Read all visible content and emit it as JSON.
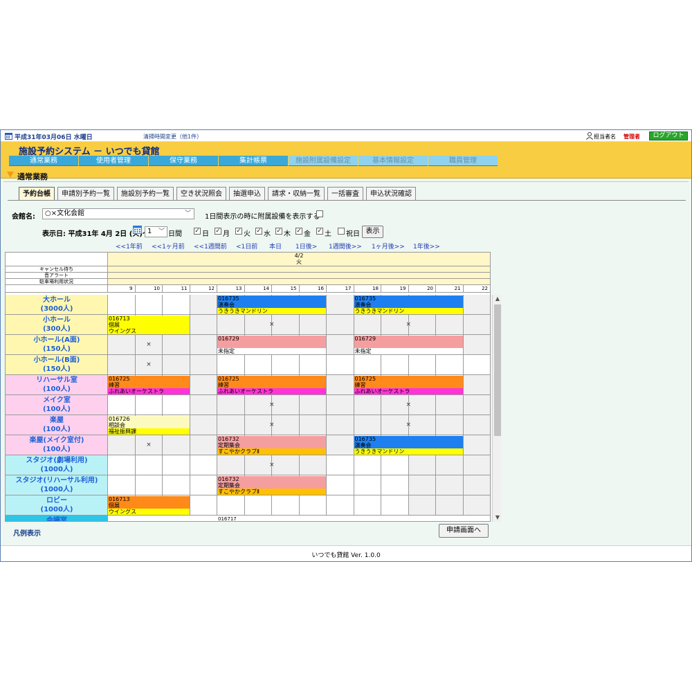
{
  "topbar": {
    "date": "平成31年03月06日 水曜日",
    "notice": "清掃時間変更（他1件）",
    "user_label": "担当者名",
    "user_role": "管理者",
    "logout": "ログアウト"
  },
  "header": {
    "title": "施設予約システム － いつでも貸館",
    "nav": [
      {
        "label": "通常業務",
        "light": false
      },
      {
        "label": "使用者管理",
        "light": false
      },
      {
        "label": "保守業務",
        "light": false
      },
      {
        "label": "集計帳票",
        "light": false
      },
      {
        "label": "施設附属設備設定",
        "light": true
      },
      {
        "label": "基本情報設定",
        "light": true
      },
      {
        "label": "職員管理",
        "light": true
      }
    ]
  },
  "section": {
    "label": "通常業務"
  },
  "tabs": [
    "予約台帳",
    "申請別予約一覧",
    "施設別予約一覧",
    "空き状況照会",
    "抽選申込",
    "請求・収納一覧",
    "一括審査",
    "申込状況確認"
  ],
  "form": {
    "hall_label": "会館名:",
    "hall_value": "○×文化会館",
    "equip_label": "1日間表示の時に附属設備を表示する",
    "date_label": "表示日: 平成31年 4月 2日 (火)～",
    "days_value": "1",
    "days_suffix": "日間",
    "weekdays": [
      {
        "label": "日",
        "checked": true
      },
      {
        "label": "月",
        "checked": true
      },
      {
        "label": "火",
        "checked": true
      },
      {
        "label": "水",
        "checked": true
      },
      {
        "label": "木",
        "checked": true
      },
      {
        "label": "金",
        "checked": true
      },
      {
        "label": "土",
        "checked": true
      },
      {
        "label": "祝日",
        "checked": false
      }
    ],
    "show_button": "表示"
  },
  "nav_links": [
    "<<1年前",
    "<<1ヶ月前",
    "<<1週間前",
    "<1日前",
    "本日",
    "1日後>",
    "1週間後>>",
    "1ヶ月後>>",
    "1年後>>"
  ],
  "grid": {
    "date": "4/2",
    "weekday": "火",
    "info_rows": [
      "キャンセル待ち",
      "音アラート",
      "駐車場利用状況"
    ],
    "hours": [
      "9",
      "10",
      "11",
      "12",
      "13",
      "14",
      "15",
      "16",
      "17",
      "18",
      "19",
      "20",
      "21",
      "22"
    ],
    "rows": [
      {
        "name": "大ホール",
        "cap": "(3000人)",
        "bg": "#fff7b0",
        "slots": [
          "w",
          "w",
          "w",
          "g",
          "b",
          "b",
          "b",
          "b",
          "g",
          "b",
          "b",
          "b",
          "b",
          "g"
        ]
      },
      {
        "name": "小ホール",
        "cap": "(300人)",
        "bg": "#fff7b0",
        "slots": [
          "b",
          "b",
          "b",
          "g",
          "g",
          "g",
          "g",
          "g",
          "g",
          "g",
          "g",
          "g",
          "g",
          "g"
        ]
      },
      {
        "name": "小ホール(A面)",
        "cap": "(150人)",
        "bg": "#fff7b0",
        "slots": [
          "g",
          "g",
          "g",
          "g",
          "b",
          "b",
          "b",
          "b",
          "g",
          "b",
          "b",
          "b",
          "b",
          "g"
        ]
      },
      {
        "name": "小ホール(B面)",
        "cap": "(150人)",
        "bg": "#fff7b0",
        "slots": [
          "g",
          "g",
          "g",
          "g",
          "w",
          "w",
          "w",
          "w",
          "w",
          "w",
          "w",
          "w",
          "w",
          "w"
        ]
      },
      {
        "name": "リハーサル室",
        "cap": "(100人)",
        "bg": "#ffd0ee",
        "slots": [
          "b",
          "b",
          "b",
          "g",
          "b",
          "b",
          "b",
          "b",
          "g",
          "b",
          "b",
          "b",
          "b",
          "g"
        ]
      },
      {
        "name": "メイク室",
        "cap": "(100人)",
        "bg": "#ffd0ee",
        "slots": [
          "w",
          "w",
          "w",
          "g",
          "g",
          "g",
          "g",
          "g",
          "g",
          "g",
          "g",
          "g",
          "g",
          "g"
        ]
      },
      {
        "name": "楽屋",
        "cap": "(100人)",
        "bg": "#ffd0ee",
        "slots": [
          "b",
          "b",
          "b",
          "g",
          "g",
          "g",
          "g",
          "g",
          "g",
          "g",
          "g",
          "g",
          "g",
          "g"
        ]
      },
      {
        "name": "楽屋(メイク室付)",
        "cap": "(100人)",
        "bg": "#ffd0ee",
        "slots": [
          "g",
          "g",
          "g",
          "g",
          "b",
          "b",
          "b",
          "b",
          "g",
          "b",
          "b",
          "b",
          "b",
          "g"
        ]
      },
      {
        "name": "スタジオ(劇場利用)",
        "cap": "(1000人)",
        "bg": "#b8f2f6",
        "slots": [
          "w",
          "w",
          "w",
          "w",
          "g",
          "g",
          "g",
          "g",
          "w",
          "w",
          "w",
          "g",
          "g",
          "g"
        ]
      },
      {
        "name": "スタジオ(リハーサル利用)",
        "cap": "(1000人)",
        "bg": "#b8f2f6",
        "slots": [
          "w",
          "w",
          "w",
          "w",
          "b",
          "b",
          "b",
          "b",
          "w",
          "w",
          "w",
          "g",
          "g",
          "g"
        ]
      },
      {
        "name": "ロビー",
        "cap": "(1000人)",
        "bg": "#b8f2f6",
        "slots": [
          "b",
          "b",
          "b",
          "w",
          "w",
          "w",
          "w",
          "w",
          "w",
          "w",
          "w",
          "g",
          "g",
          "g"
        ]
      }
    ],
    "bookings": [
      {
        "row": 0,
        "start": 4,
        "end": 8,
        "lines": [
          [
            "016735",
            "#1e7ff0"
          ],
          [
            "演奏会",
            "#1e7ff0"
          ],
          [
            "うきうきマンドリン",
            "#ffff00"
          ]
        ]
      },
      {
        "row": 0,
        "start": 9,
        "end": 13,
        "lines": [
          [
            "016735",
            "#1e7ff0"
          ],
          [
            "演奏会",
            "#1e7ff0"
          ],
          [
            "うきうきマンドリン",
            "#ffff00"
          ]
        ]
      },
      {
        "row": 1,
        "start": 0,
        "end": 3,
        "lines": [
          [
            "016713",
            "#ffff00"
          ],
          [
            "個展",
            "#ffff00"
          ],
          [
            "ウイングス",
            "#ffff00"
          ]
        ]
      },
      {
        "row": 2,
        "start": 4,
        "end": 8,
        "lines": [
          [
            "016729",
            "#f59ea0"
          ],
          [
            "",
            "#f59ea0"
          ],
          [
            "未指定",
            "#ffffff"
          ]
        ]
      },
      {
        "row": 2,
        "start": 9,
        "end": 13,
        "lines": [
          [
            "016729",
            "#f59ea0"
          ],
          [
            "",
            "#f59ea0"
          ],
          [
            "未指定",
            "#ffffff"
          ]
        ]
      },
      {
        "row": 4,
        "start": 0,
        "end": 3,
        "lines": [
          [
            "016725",
            "#ff8a1a"
          ],
          [
            "練習",
            "#ff8a1a"
          ],
          [
            "ふれあいオーケストラ",
            "#ff33d9"
          ]
        ]
      },
      {
        "row": 4,
        "start": 4,
        "end": 8,
        "lines": [
          [
            "016725",
            "#ff8a1a"
          ],
          [
            "練習",
            "#ff8a1a"
          ],
          [
            "ふれあいオーケストラ",
            "#ff33d9"
          ]
        ]
      },
      {
        "row": 4,
        "start": 9,
        "end": 13,
        "lines": [
          [
            "016725",
            "#ff8a1a"
          ],
          [
            "練習",
            "#ff8a1a"
          ],
          [
            "ふれあいオーケストラ",
            "#ff33d9"
          ]
        ]
      },
      {
        "row": 6,
        "start": 0,
        "end": 3,
        "lines": [
          [
            "016726",
            "#fdfac0"
          ],
          [
            "相談会",
            "#fdfac0"
          ],
          [
            "福祉振興課",
            "#ffff00"
          ]
        ]
      },
      {
        "row": 7,
        "start": 4,
        "end": 8,
        "lines": [
          [
            "016732",
            "#f59ea0"
          ],
          [
            "定期集会",
            "#f59ea0"
          ],
          [
            "すこやかクラブⅡ",
            "#ffc000"
          ]
        ]
      },
      {
        "row": 7,
        "start": 9,
        "end": 13,
        "lines": [
          [
            "016735",
            "#1e7ff0"
          ],
          [
            "演奏会",
            "#1e7ff0"
          ],
          [
            "うきうきマンドリン",
            "#ffff00"
          ]
        ]
      },
      {
        "row": 9,
        "start": 4,
        "end": 8,
        "lines": [
          [
            "016732",
            "#f59ea0"
          ],
          [
            "定期集会",
            "#f59ea0"
          ],
          [
            "すこやかクラブⅡ",
            "#ffc000"
          ]
        ]
      },
      {
        "row": 10,
        "start": 0,
        "end": 3,
        "lines": [
          [
            "016713",
            "#ff8a1a"
          ],
          [
            "個展",
            "#ff8a1a"
          ],
          [
            "ウイングス",
            "#ffff00"
          ]
        ]
      }
    ],
    "crosses": [
      {
        "row": 1,
        "start": 4,
        "end": 8
      },
      {
        "row": 1,
        "start": 9,
        "end": 13
      },
      {
        "row": 2,
        "start": 0,
        "end": 3
      },
      {
        "row": 3,
        "start": 0,
        "end": 3
      },
      {
        "row": 5,
        "start": 4,
        "end": 8
      },
      {
        "row": 5,
        "start": 9,
        "end": 13
      },
      {
        "row": 6,
        "start": 4,
        "end": 8
      },
      {
        "row": 6,
        "start": 9,
        "end": 13
      },
      {
        "row": 7,
        "start": 0,
        "end": 3
      },
      {
        "row": 8,
        "start": 4,
        "end": 8
      }
    ],
    "partial_row": {
      "name": "会議室",
      "code": "016717"
    },
    "cross_symbol": "×"
  },
  "legend_label": "凡例表示",
  "apply_button": "申請画面へ",
  "footer": "いつでも貸館 Ver. 1.0.0"
}
